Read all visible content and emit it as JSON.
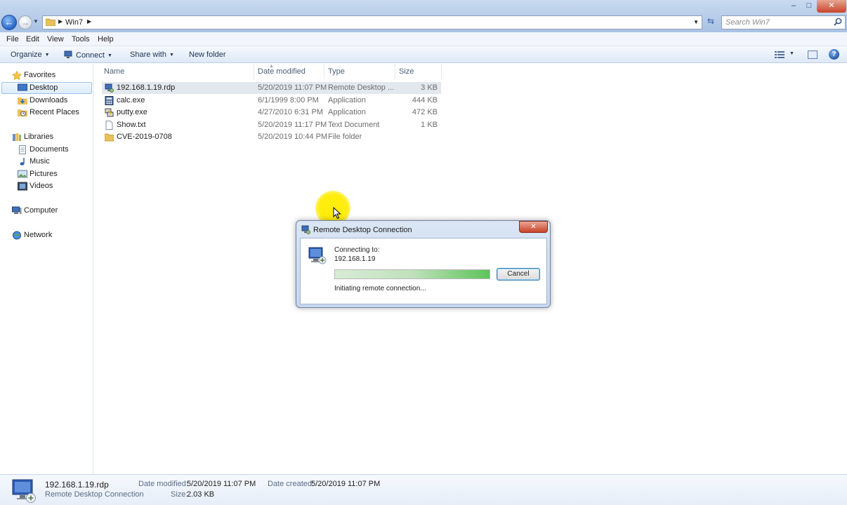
{
  "window": {
    "address_path": "Win7",
    "search_placeholder": "Search Win7",
    "minimize": "–",
    "maximize": "□",
    "close": "✕"
  },
  "menu": [
    "File",
    "Edit",
    "View",
    "Tools",
    "Help"
  ],
  "commands": {
    "organize": "Organize",
    "connect": "Connect",
    "share_with": "Share with",
    "new_folder": "New folder"
  },
  "nav": {
    "favorites": "Favorites",
    "desktop": "Desktop",
    "downloads": "Downloads",
    "recent_places": "Recent Places",
    "libraries": "Libraries",
    "documents": "Documents",
    "music": "Music",
    "pictures": "Pictures",
    "videos": "Videos",
    "computer": "Computer",
    "network": "Network"
  },
  "columns": {
    "name": "Name",
    "date": "Date modified",
    "type": "Type",
    "size": "Size"
  },
  "files": [
    {
      "name": "192.168.1.19.rdp",
      "date": "5/20/2019 11:07 PM",
      "type": "Remote Desktop ...",
      "size": "3 KB"
    },
    {
      "name": "calc.exe",
      "date": "6/1/1999 8:00 PM",
      "type": "Application",
      "size": "444 KB"
    },
    {
      "name": "putty.exe",
      "date": "4/27/2010 6:31 PM",
      "type": "Application",
      "size": "472 KB"
    },
    {
      "name": "Show.txt",
      "date": "5/20/2019 11:17 PM",
      "type": "Text Document",
      "size": "1 KB"
    },
    {
      "name": "CVE-2019-0708",
      "date": "5/20/2019 10:44 PM",
      "type": "File folder",
      "size": ""
    }
  ],
  "details": {
    "name": "192.168.1.19.rdp",
    "type": "Remote Desktop Connection",
    "modified_label": "Date modified:",
    "modified_value": "5/20/2019 11:07 PM",
    "created_label": "Date created:",
    "created_value": "5/20/2019 11:07 PM",
    "size_label": "Size:",
    "size_value": "2.03 KB"
  },
  "dialog": {
    "title": "Remote Desktop Connection",
    "connecting_label": "Connecting to:",
    "target": "192.168.1.19",
    "progress": 1.0,
    "status": "Initiating remote connection...",
    "cancel_label": "Cancel"
  },
  "colors": {
    "accent": "#2765c7",
    "selection": "#dcebfc",
    "progress_green": "#5ec45a",
    "cursor_highlight": "#ffec00"
  }
}
